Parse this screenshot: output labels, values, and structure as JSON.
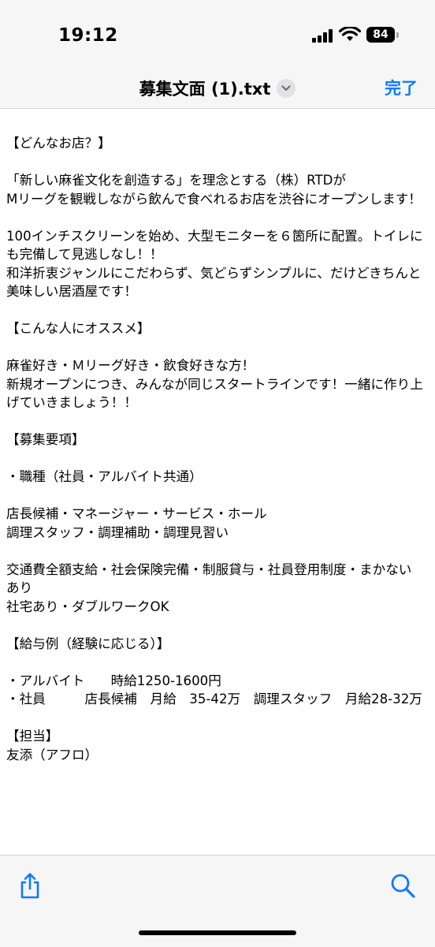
{
  "status_bar": {
    "time": "19:12",
    "battery_level": "84"
  },
  "nav": {
    "title": "募集文面 (1).txt",
    "done_label": "完了",
    "accent_color": "#0a7bff"
  },
  "document": {
    "text": "【どんなお店？】\n\n「新しい麻雀文化を創造する」を理念とする（株）RTDが\nMリーグを観戦しながら飲んで食べれるお店を渋谷にオープンします！\n\n100インチスクリーンを始め、大型モニターを６箇所に配置。トイレにも完備して見逃しなし！！\n和洋折衷ジャンルにこだわらず、気どらずシンプルに、だけどきちんと美味しい居酒屋です！\n\n【こんな人にオススメ】\n\n麻雀好き・Ｍリーグ好き・飲食好きな方！\n新規オープンにつき、みんなが同じスタートラインです！一緒に作り上げていきましょう！！\n\n【募集要項】\n\n・職種（社員・アルバイト共通）\n\n店長候補・マネージャー・サービス・ホール\n調理スタッフ・調理補助・調理見習い\n\n交通費全額支給・社会保険完備・制服貸与・社員登用制度・まかないあり\n社宅あり・ダブルワークOK\n\n【給与例（経験に応じる）】\n\n・アルバイト　　時給1250-1600円\n・社員　　　店長候補　月給　35-42万　調理スタッフ　月給28-32万\n\n【担当】\n友添（アフロ）"
  },
  "toolbar": {
    "share_icon": "share-icon",
    "search_icon": "search-icon"
  }
}
